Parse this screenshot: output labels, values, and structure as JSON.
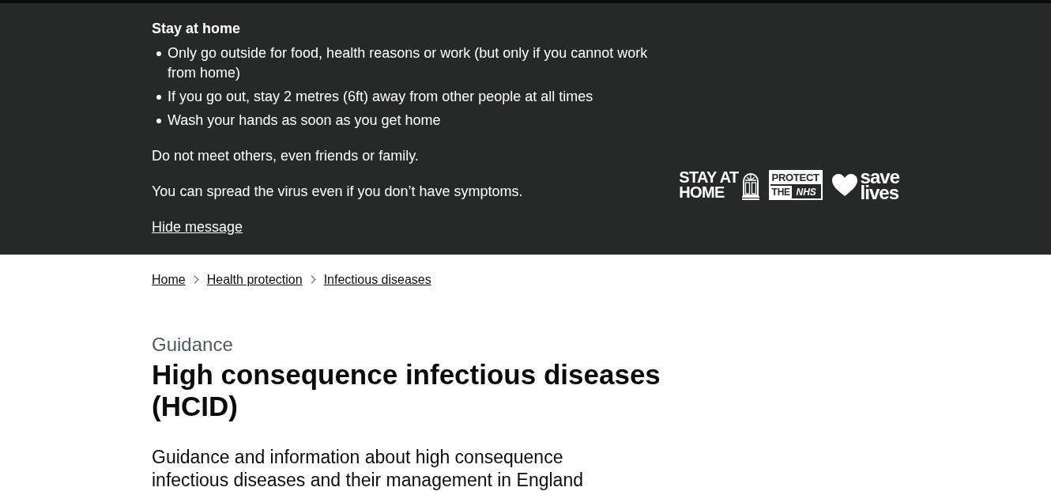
{
  "banner": {
    "heading": "Stay at home",
    "bullets": [
      "Only go outside for food, health reasons or work (but only if you cannot work from home)",
      "If you go out, stay 2 metres (6ft) away from other people at all times",
      "Wash your hands as soon as you get home"
    ],
    "paragraphs": [
      "Do not meet others, even friends or family.",
      "You can spread the virus even if you don’t have symptoms."
    ],
    "hide_link": "Hide message"
  },
  "campaign_logo": {
    "stay_at_home": [
      "STAY AT",
      "HOME"
    ],
    "protect": "PROTECT",
    "the": "THE",
    "nhs": "NHS",
    "save_lives": [
      "save",
      "lives"
    ]
  },
  "breadcrumbs": [
    "Home",
    "Health protection",
    "Infectious diseases"
  ],
  "page": {
    "caption": "Guidance",
    "title": "High consequence infectious diseases (HCID)",
    "lead": "Guidance and information about high consequence infectious diseases and their management in England"
  }
}
